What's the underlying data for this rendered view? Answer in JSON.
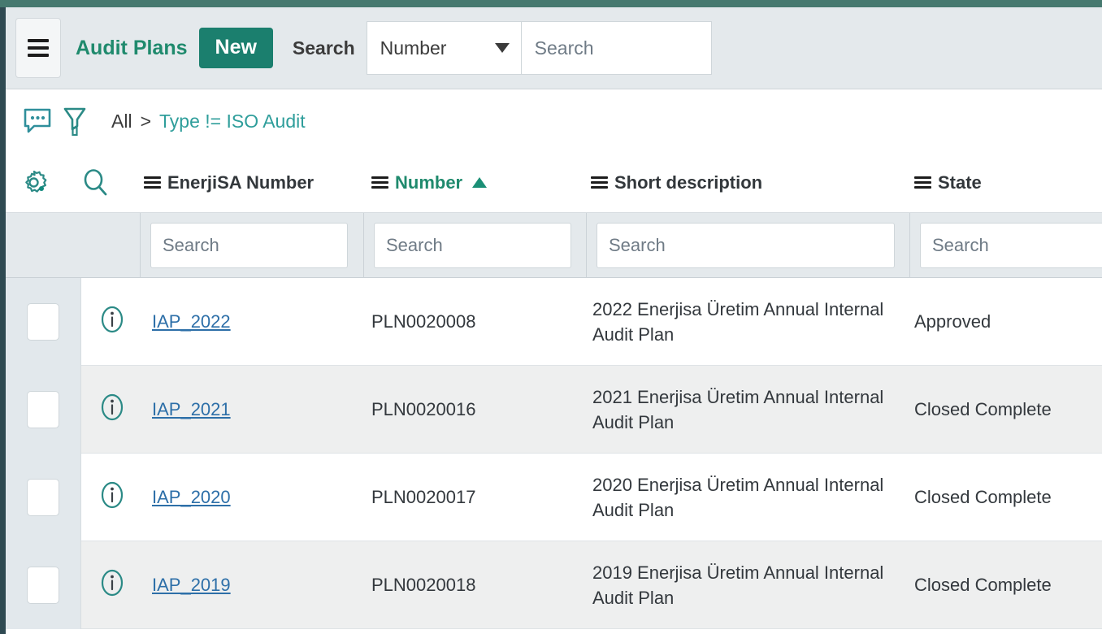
{
  "theme": {
    "top_strip_color": "#46796f",
    "left_rail_color": "#2f4a52",
    "accent_teal": "#1f8a6d",
    "new_button_color": "#1b7f6e",
    "link_color": "#2d6fa8",
    "header_bg": "#e4e9ec"
  },
  "header": {
    "menu_icon": "hamburger-icon",
    "title": "Audit Plans",
    "new_label": "New",
    "search_label": "Search",
    "search_field_selected": "Number",
    "search_field_options": [
      "Number"
    ],
    "search_placeholder": "Search",
    "search_value": "",
    "caret_icon": "chevron-down-icon"
  },
  "toolbar": {
    "comment_icon": "speech-bubble-icon",
    "filter_icon": "funnel-icon",
    "settings_icon": "gear-icon",
    "search_icon": "magnifier-icon",
    "breadcrumb": {
      "root": "All",
      "separator": ">",
      "condition": "Type != ISO Audit"
    }
  },
  "table": {
    "columns": [
      {
        "label": "EnerjiSA Number",
        "sorted": false,
        "sort_dir": "",
        "menu_icon": "column-menu-icon",
        "filter_placeholder": "Search",
        "filter_value": ""
      },
      {
        "label": "Number",
        "sorted": true,
        "sort_dir": "asc",
        "menu_icon": "column-menu-icon",
        "filter_placeholder": "Search",
        "filter_value": ""
      },
      {
        "label": "Short description",
        "sorted": false,
        "sort_dir": "",
        "menu_icon": "column-menu-icon",
        "filter_placeholder": "Search",
        "filter_value": ""
      },
      {
        "label": "State",
        "sorted": false,
        "sort_dir": "",
        "menu_icon": "column-menu-icon",
        "filter_placeholder": "Search",
        "filter_value": ""
      }
    ],
    "rows": [
      {
        "checkbox_checked": false,
        "info_icon": "info-circle-icon",
        "enerjisa_number": "IAP_2022",
        "number": "PLN0020008",
        "short_description": "2022 Enerjisa Üretim Annual Internal Audit Plan",
        "state": "Approved"
      },
      {
        "checkbox_checked": false,
        "info_icon": "info-circle-icon",
        "enerjisa_number": "IAP_2021",
        "number": "PLN0020016",
        "short_description": "2021 Enerjisa Üretim Annual Internal Audit Plan",
        "state": "Closed Complete"
      },
      {
        "checkbox_checked": false,
        "info_icon": "info-circle-icon",
        "enerjisa_number": "IAP_2020",
        "number": "PLN0020017",
        "short_description": "2020 Enerjisa Üretim Annual Internal Audit Plan",
        "state": "Closed Complete"
      },
      {
        "checkbox_checked": false,
        "info_icon": "info-circle-icon",
        "enerjisa_number": "IAP_2019",
        "number": "PLN0020018",
        "short_description": "2019 Enerjisa Üretim Annual Internal Audit Plan",
        "state": "Closed Complete"
      }
    ]
  }
}
